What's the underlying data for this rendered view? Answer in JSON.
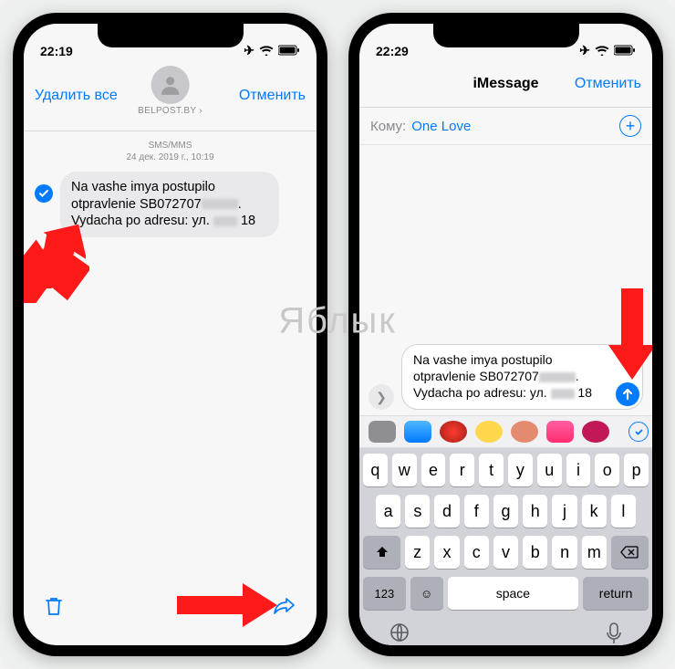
{
  "watermark": "Яблык",
  "left": {
    "status_time": "22:19",
    "nav_left": "Удалить все",
    "nav_right": "Отменить",
    "contact_name": "BELPOST.BY",
    "ts_line1": "SMS/MMS",
    "ts_line2": "24 дек. 2019 г., 10:19",
    "msg_part1": "Na vashe imya postupilo otpravlenie SB072707",
    "msg_part2": ". Vydacha po adresu: ул. ",
    "msg_part3": " 18"
  },
  "right": {
    "status_time": "22:29",
    "nav_title": "iMessage",
    "nav_right": "Отменить",
    "to_label": "Кому:",
    "to_value": "One Love",
    "msg_part1": "Na vashe imya postupilo otpravlenie SB072707",
    "msg_part2": ". Vydacha po adresu: ул. ",
    "msg_part3": " 18",
    "keyboard": {
      "row1": [
        "q",
        "w",
        "e",
        "r",
        "t",
        "y",
        "u",
        "i",
        "o",
        "p"
      ],
      "row2": [
        "a",
        "s",
        "d",
        "f",
        "g",
        "h",
        "j",
        "k",
        "l"
      ],
      "row3": [
        "z",
        "x",
        "c",
        "v",
        "b",
        "n",
        "m"
      ],
      "numkey": "123",
      "space": "space",
      "return": "return"
    }
  }
}
